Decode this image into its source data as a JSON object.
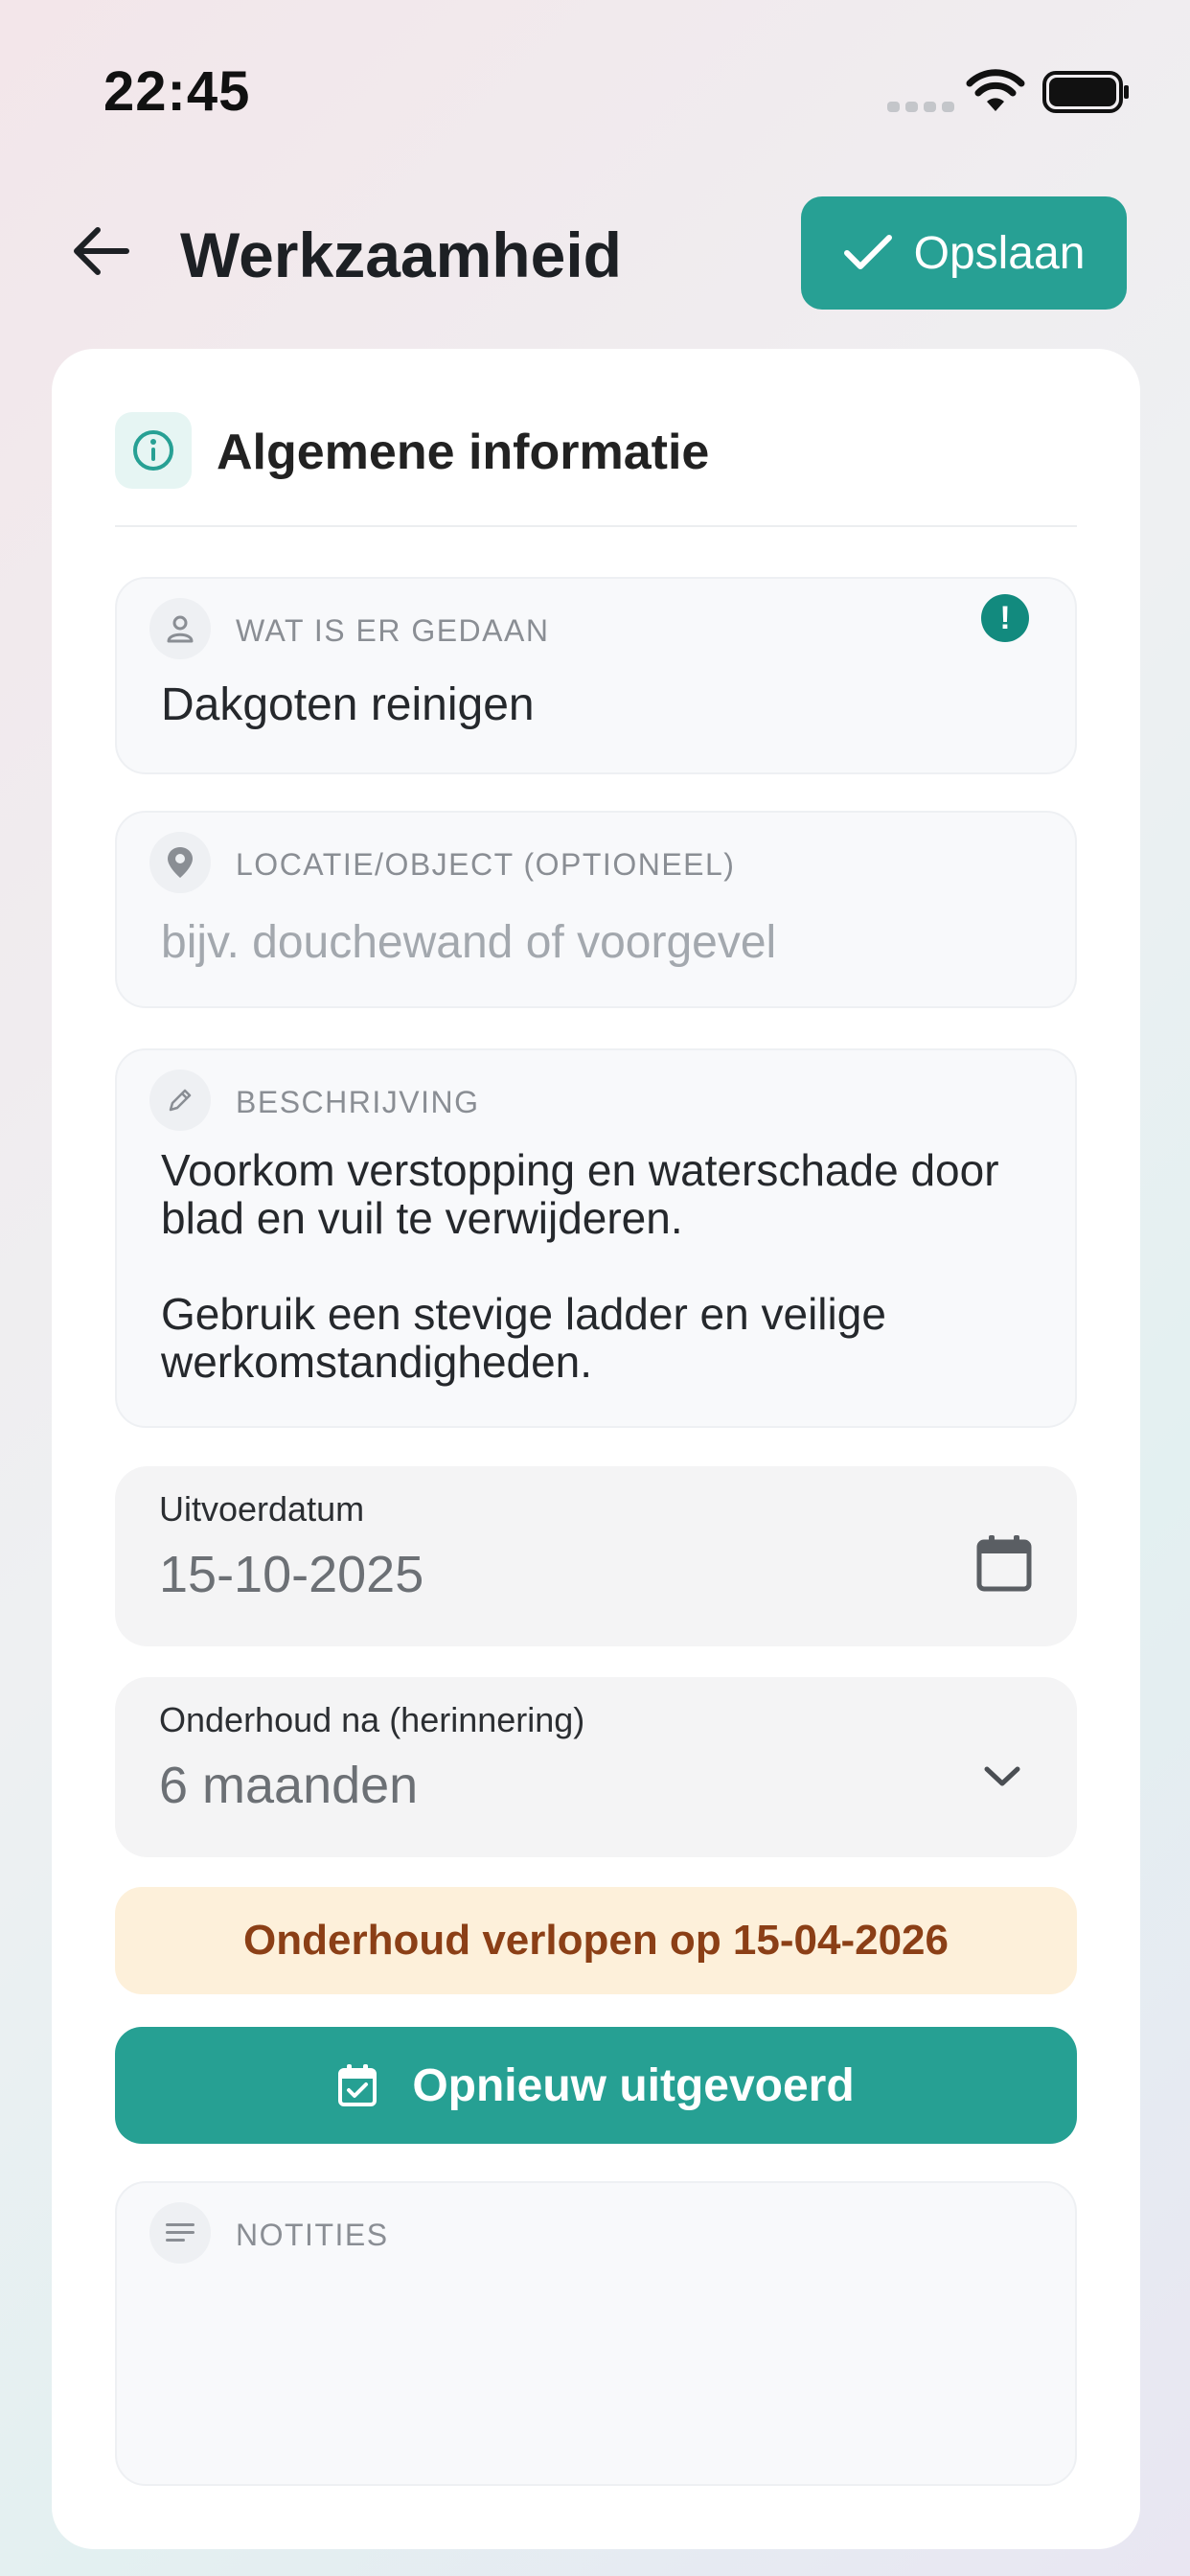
{
  "status_bar": {
    "time": "22:45"
  },
  "header": {
    "title": "Werkzaamheid",
    "save_label": "Opslaan"
  },
  "section": {
    "title": "Algemene informatie"
  },
  "fields": {
    "what": {
      "label": "WAT IS ER GEDAAN",
      "value": "Dakgoten reinigen",
      "badge": "!"
    },
    "location": {
      "label": "LOCATIE/OBJECT (OPTIONEEL)",
      "placeholder": "bijv. douchewand of voorgevel"
    },
    "description": {
      "label": "BESCHRIJVING",
      "value": "Voorkom verstopping en waterschade door blad en vuil te verwijderen.\n\nGebruik een stevige ladder en veilige werkomstandigheden."
    },
    "date": {
      "label": "Uitvoerdatum",
      "value": "15-10-2025"
    },
    "maintenance": {
      "label": "Onderhoud na (herinnering)",
      "value": "6 maanden"
    },
    "notes": {
      "label": "NOTITIES"
    }
  },
  "banner": {
    "text": "Onderhoud verlopen op 15-04-2026"
  },
  "redo_button": {
    "label": "Opnieuw uitgevoerd"
  },
  "colors": {
    "accent": "#27a094",
    "warning_bg": "#fdf0da",
    "warning_text": "#8b3f16"
  },
  "icons": [
    "back-arrow-icon",
    "check-icon",
    "info-icon",
    "user-icon",
    "location-pin-icon",
    "pencil-icon",
    "calendar-icon",
    "chevron-down-icon",
    "calendar-check-icon",
    "notes-icon"
  ]
}
